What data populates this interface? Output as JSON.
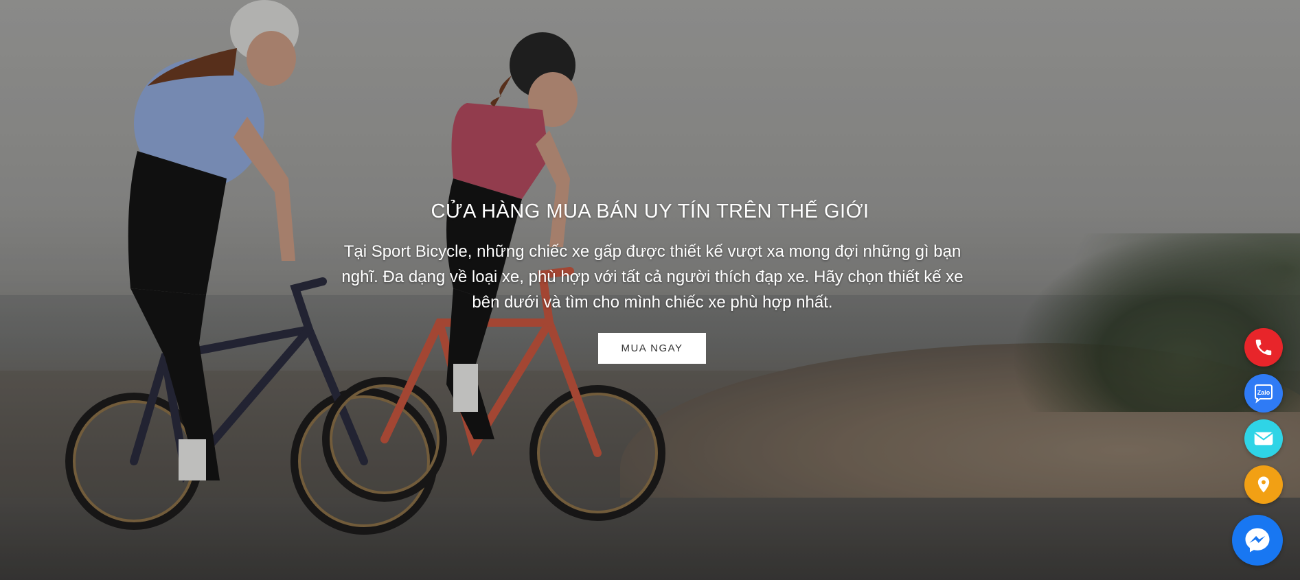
{
  "hero": {
    "headline": "CỬA HÀNG MUA BÁN UY TÍN TRÊN THẾ GIỚI",
    "description": "Tại Sport Bicycle, những chiếc xe gấp được thiết kế vượt xa mong đợi những gì bạn nghĩ. Đa dạng về loại xe, phù hợp với tất cả người thích đạp xe. Hãy chọn thiết kế xe bên dưới và tìm cho mình chiếc xe phù hợp nhất.",
    "cta_label": "MUA NGAY"
  },
  "floating_contacts": [
    {
      "name": "phone",
      "icon": "phone-icon",
      "color": "#e8252a"
    },
    {
      "name": "zalo",
      "icon": "zalo-icon",
      "label": "Zalo",
      "color": "#2f7bf5"
    },
    {
      "name": "email",
      "icon": "mail-icon",
      "color": "#2fd4e6"
    },
    {
      "name": "map",
      "icon": "map-pin-icon",
      "color": "#f2a014"
    },
    {
      "name": "messenger",
      "icon": "messenger-icon",
      "color": "#1877f2"
    }
  ]
}
